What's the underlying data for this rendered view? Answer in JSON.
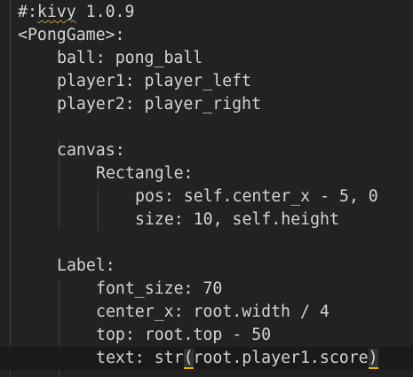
{
  "editor": {
    "lines": [
      {
        "indent": 0,
        "prefix": "#:",
        "squiggle": "kivy",
        "suffix": " 1.0.9"
      },
      {
        "indent": 0,
        "text": "<PongGame>:"
      },
      {
        "indent": 1,
        "text": "ball: pong_ball"
      },
      {
        "indent": 1,
        "text": "player1: player_left"
      },
      {
        "indent": 1,
        "text": "player2: player_right"
      },
      {
        "indent": 0,
        "text": ""
      },
      {
        "indent": 1,
        "text": "canvas:"
      },
      {
        "indent": 2,
        "text": "Rectangle:"
      },
      {
        "indent": 3,
        "text": "pos: self.center_x - 5, 0"
      },
      {
        "indent": 3,
        "text": "size: 10, self.height"
      },
      {
        "indent": 0,
        "text": ""
      },
      {
        "indent": 1,
        "text": "Label:"
      },
      {
        "indent": 2,
        "text": "font_size: 70"
      },
      {
        "indent": 2,
        "text": "center_x: root.width / 4"
      },
      {
        "indent": 2,
        "text": "top: root.top - 50"
      },
      {
        "indent": 2,
        "current": true,
        "prefix": "text: str",
        "open": "(",
        "middle": "root.player1.score",
        "close": ")"
      }
    ]
  }
}
